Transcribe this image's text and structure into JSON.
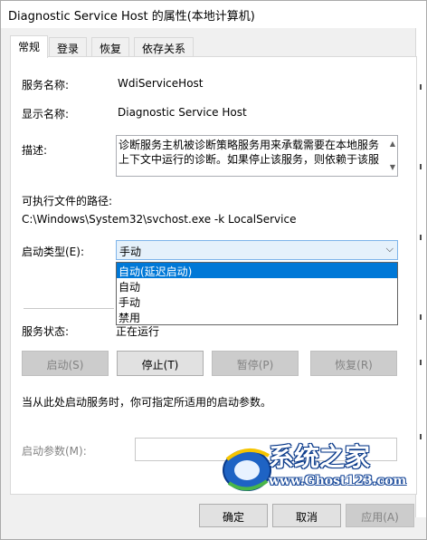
{
  "window": {
    "title": "Diagnostic Service Host 的属性(本地计算机)"
  },
  "tabs": [
    {
      "label": "常规"
    },
    {
      "label": "登录"
    },
    {
      "label": "恢复"
    },
    {
      "label": "依存关系"
    }
  ],
  "general": {
    "service_name_label": "服务名称:",
    "service_name": "WdiServiceHost",
    "display_name_label": "显示名称:",
    "display_name": "Diagnostic Service Host",
    "description_label": "描述:",
    "description_lines": [
      "诊断服务主机被诊断策略服务用来承载需要在本地服务",
      "上下文中运行的诊断。如果停止该服务，则依赖于该服"
    ],
    "exe_path_label": "可执行文件的路径:",
    "exe_path": "C:\\Windows\\System32\\svchost.exe -k LocalService",
    "startup_type_label": "启动类型(E):",
    "startup_type_value": "手动",
    "startup_options": [
      "自动(延迟启动)",
      "自动",
      "手动",
      "禁用"
    ],
    "service_status_label": "服务状态:",
    "service_status": "正在运行",
    "start_button": "启动(S)",
    "stop_button": "停止(T)",
    "pause_button": "暂停(P)",
    "resume_button": "恢复(R)",
    "hint": "当从此处启动服务时，你可指定所适用的启动参数。",
    "start_params_label": "启动参数(M):",
    "start_params_value": ""
  },
  "footer": {
    "ok_button": "确定",
    "cancel_button": "取消",
    "apply_button": "应用(A)"
  },
  "watermark": {
    "name": "系统之家",
    "url": "www.Ghost123.com"
  },
  "colors": {
    "selection": "#0078d7",
    "focus_border": "#0078d7",
    "combo_bg": "#e5f1fb"
  }
}
